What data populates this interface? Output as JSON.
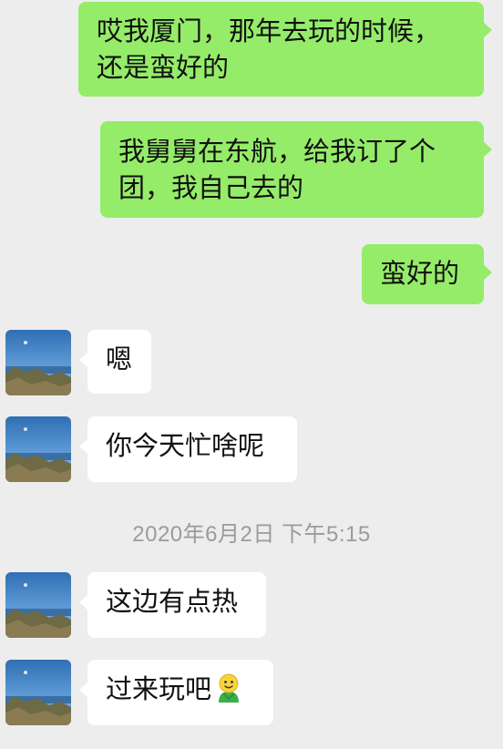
{
  "messages": [
    {
      "side": "sent",
      "lines": [
        "哎我厦门，那年去玩的时候，",
        "还是蛮好的"
      ]
    },
    {
      "side": "sent",
      "lines": [
        "我舅舅在东航，给我订了个",
        "团，我自己去的"
      ]
    },
    {
      "side": "sent",
      "lines": [
        "蛮好的"
      ]
    },
    {
      "side": "recv",
      "lines": [
        "嗯"
      ]
    },
    {
      "side": "recv",
      "lines": [
        "你今天忙啥呢"
      ]
    },
    {
      "side": "recv",
      "lines": [
        "这边有点热"
      ]
    },
    {
      "side": "recv",
      "lines": [
        "过来玩吧"
      ],
      "emoji": "smiling-face-emoji"
    }
  ],
  "timestamp": "2020年6月2日 下午5:15",
  "colors": {
    "sent_bubble": "#95ec69",
    "recv_bubble": "#ffffff",
    "background": "#ededed",
    "timestamp": "#9b9b9b"
  },
  "avatar": {
    "icon": "landscape-sky-sea-avatar"
  }
}
